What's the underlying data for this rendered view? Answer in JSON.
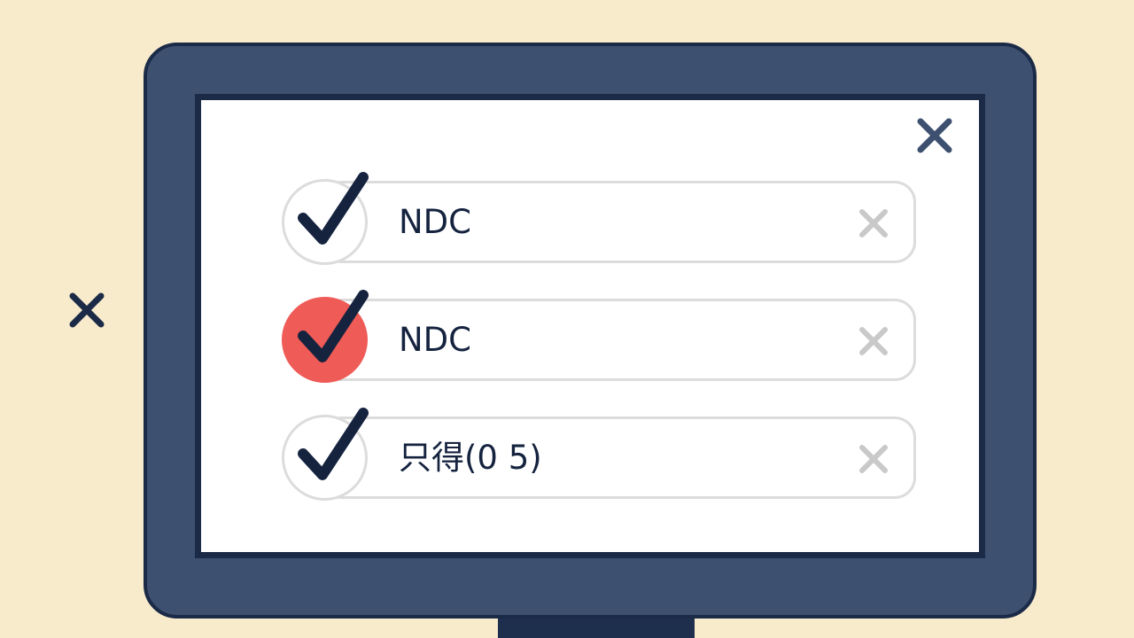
{
  "icons": {
    "outside_close": "close-icon",
    "dialog_close": "close-icon",
    "row_check": "checkmark-icon",
    "row_remove": "close-icon"
  },
  "colors": {
    "background": "#f8ebcc",
    "monitor_frame": "#3e5070",
    "ink": "#1a2a47",
    "selected_accent": "#ef5b57",
    "row_border": "#dcdcdc",
    "remove_icon": "#c9c9c9"
  },
  "list": {
    "items": [
      {
        "label": "NDC",
        "checked": true,
        "highlighted": false
      },
      {
        "label": "NDC",
        "checked": true,
        "highlighted": true
      },
      {
        "label": "只得(0 5)",
        "checked": true,
        "highlighted": false
      }
    ]
  }
}
